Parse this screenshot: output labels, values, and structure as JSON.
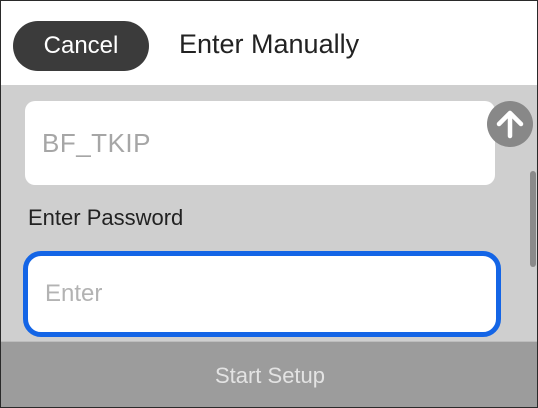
{
  "header": {
    "cancel_label": "Cancel",
    "title": "Enter Manually"
  },
  "ssid": {
    "value": "BF_TKIP"
  },
  "password": {
    "label": "Enter Password",
    "placeholder": "Enter"
  },
  "footer": {
    "start_label": "Start Setup"
  },
  "icons": {
    "scroll_up": "arrow-up-icon"
  },
  "colors": {
    "accent_focus": "#1465e6",
    "cancel_bg": "#3b3b3b",
    "content_bg": "#cfcfcf",
    "disabled_button": "#9c9c9c"
  }
}
